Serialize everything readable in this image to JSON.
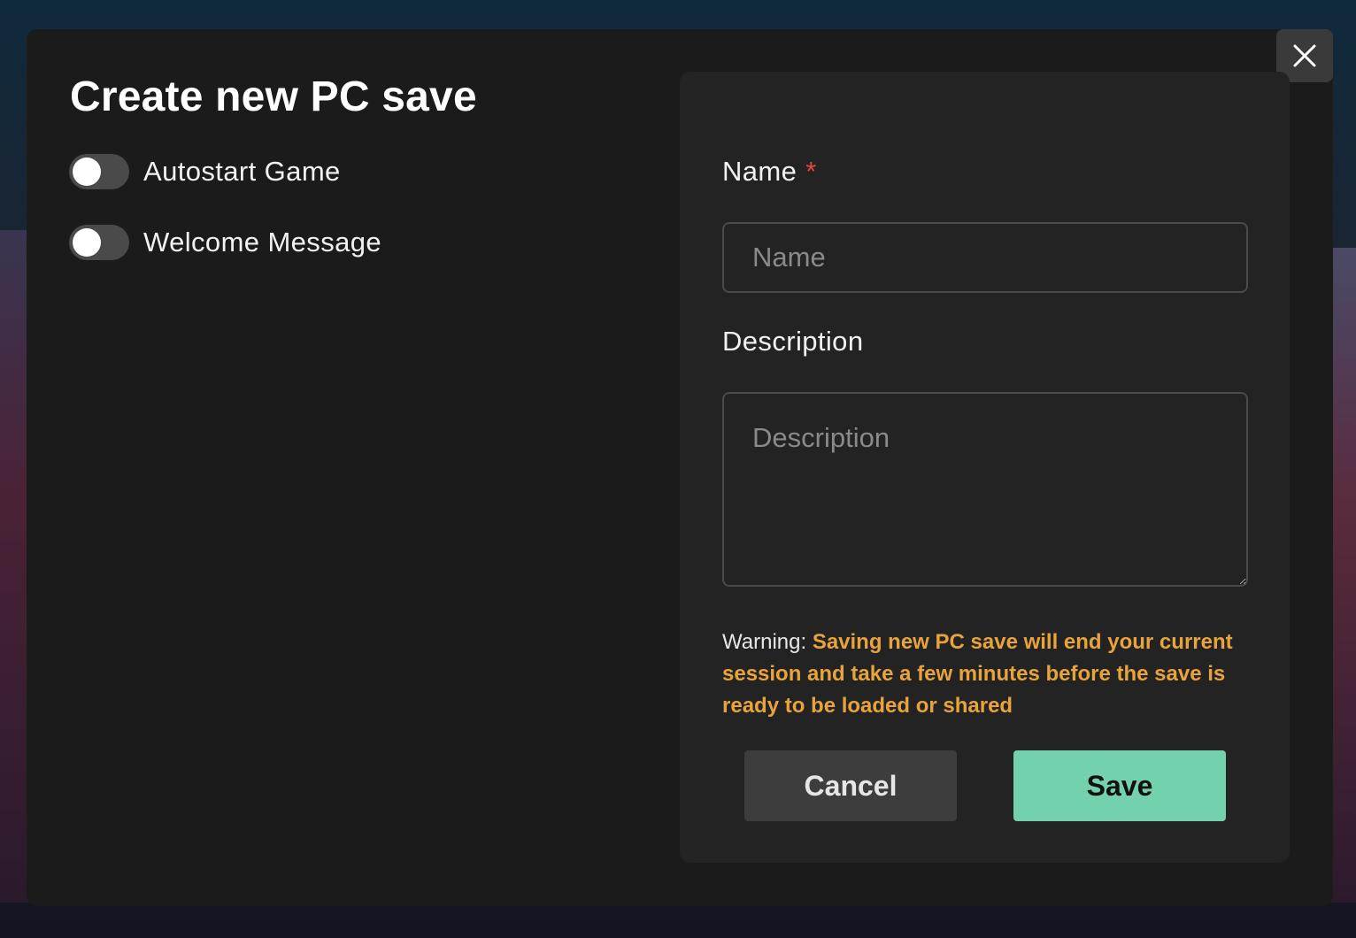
{
  "dialog": {
    "title": "Create new PC save"
  },
  "toggles": [
    {
      "label": "Autostart Game",
      "enabled": false
    },
    {
      "label": "Welcome Message",
      "enabled": false
    }
  ],
  "form": {
    "name_label": "Name",
    "name_required_mark": "*",
    "name_placeholder": "Name",
    "name_value": "",
    "description_label": "Description",
    "description_placeholder": "Description",
    "description_value": ""
  },
  "warning": {
    "prefix": "Warning: ",
    "message": "Saving new PC save will end your current session and take a few minutes before the save is ready to be loaded or shared"
  },
  "buttons": {
    "cancel": "Cancel",
    "save": "Save"
  },
  "icons": {
    "close": "close-icon"
  },
  "colors": {
    "accent": "#74d1ad",
    "warning": "#e8a33a",
    "required": "#e5483d",
    "modal_bg": "#1b1b1b",
    "panel_bg": "#232323"
  }
}
